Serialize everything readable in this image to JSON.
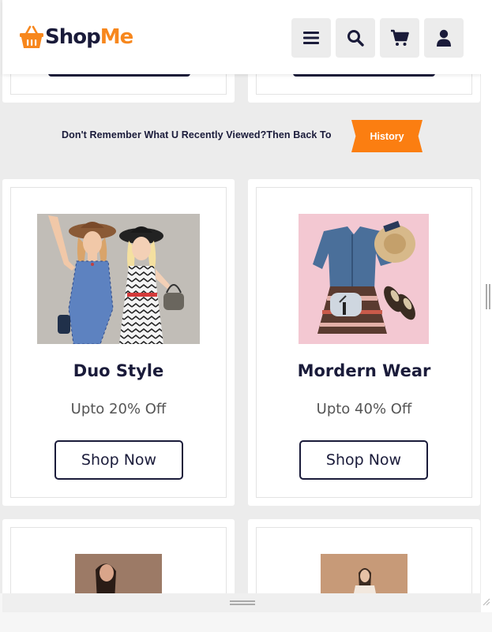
{
  "header": {
    "brand_part1": "Shop",
    "brand_part2": "Me",
    "icons": [
      "basket-logo-icon",
      "menu-icon",
      "search-icon",
      "cart-icon",
      "user-icon"
    ]
  },
  "history_banner": {
    "text": "Don't Remember What U Recently Viewed?Then Back To",
    "button_label": "History"
  },
  "products": [
    {
      "title": "Duo Style",
      "offer": "Upto 20% Off",
      "button_label": "Shop Now"
    },
    {
      "title": "Mordern Wear",
      "offer": "Upto 40% Off",
      "button_label": "Shop Now"
    }
  ],
  "colors": {
    "brand_orange": "#f7871d",
    "navy": "#1a1b3a",
    "history_orange": "#fb7e11",
    "page_bg": "#ececec"
  }
}
